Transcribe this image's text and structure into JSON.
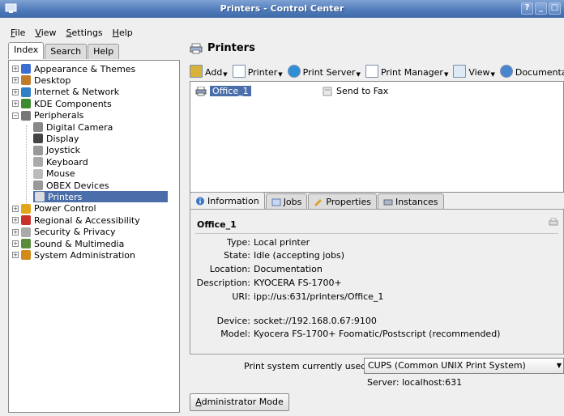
{
  "window": {
    "title": "Printers - Control Center",
    "buttons": [
      "?",
      "_",
      "□"
    ]
  },
  "menu": [
    {
      "label": "File",
      "key": "F",
      "rest": "ile"
    },
    {
      "label": "View",
      "key": "V",
      "rest": "iew"
    },
    {
      "label": "Settings",
      "key": "S",
      "rest": "ettings"
    },
    {
      "label": "Help",
      "key": "H",
      "rest": "elp"
    }
  ],
  "left_tabs": [
    "Index",
    "Search",
    "Help"
  ],
  "tree": [
    {
      "label": "Appearance & Themes",
      "expander": "+",
      "icon": "appearance-icon",
      "color": "#3a6ed1"
    },
    {
      "label": "Desktop",
      "expander": "+",
      "icon": "desktop-icon",
      "color": "#c07c2a"
    },
    {
      "label": "Internet & Network",
      "expander": "+",
      "icon": "network-icon",
      "color": "#2f7fc9"
    },
    {
      "label": "KDE Components",
      "expander": "+",
      "icon": "kde-components-icon",
      "color": "#3c8a2e"
    },
    {
      "label": "Peripherals",
      "expander": "−",
      "icon": "peripherals-icon",
      "color": "#777777"
    },
    {
      "label": "Digital Camera",
      "icon": "camera-icon",
      "color": "#888888"
    },
    {
      "label": "Display",
      "icon": "display-icon",
      "color": "#444444"
    },
    {
      "label": "Joystick",
      "icon": "joystick-icon",
      "color": "#999999"
    },
    {
      "label": "Keyboard",
      "icon": "keyboard-icon",
      "color": "#aaaaaa"
    },
    {
      "label": "Mouse",
      "icon": "mouse-icon",
      "color": "#bbbbbb"
    },
    {
      "label": "OBEX Devices",
      "icon": "obex-icon",
      "color": "#999999"
    },
    {
      "label": "Printers",
      "icon": "printer-icon",
      "color": "#dddddd",
      "selected": true
    },
    {
      "label": "Power Control",
      "expander": "+",
      "icon": "power-icon",
      "color": "#e2a51c"
    },
    {
      "label": "Regional & Accessibility",
      "expander": "+",
      "icon": "regional-icon",
      "color": "#c8322b"
    },
    {
      "label": "Security & Privacy",
      "expander": "+",
      "icon": "security-icon",
      "color": "#aaaaaa"
    },
    {
      "label": "Sound & Multimedia",
      "expander": "+",
      "icon": "sound-icon",
      "color": "#5a8a3c"
    },
    {
      "label": "System Administration",
      "expander": "+",
      "icon": "sysadmin-icon",
      "color": "#d28a1c"
    }
  ],
  "panel": {
    "title": "Printers"
  },
  "toolbar": [
    {
      "label": "Add",
      "icon": "add-wand-icon",
      "dropdown": true
    },
    {
      "label": "Printer",
      "icon": "printer-doc-icon",
      "dropdown": true
    },
    {
      "label": "Print Server",
      "icon": "print-server-icon",
      "dropdown": true
    },
    {
      "label": "Print Manager",
      "icon": "print-manager-icon",
      "dropdown": true
    },
    {
      "label": "View",
      "icon": "view-icon",
      "dropdown": true
    },
    {
      "label": "Documentation",
      "icon": "documentation-icon",
      "dropdown": true
    }
  ],
  "printers": [
    {
      "label": "Office_1",
      "icon": "printer-icon",
      "selected": true
    },
    {
      "label": "Send to Fax",
      "icon": "fax-icon",
      "selected": false
    }
  ],
  "info_tabs": [
    {
      "label": "Information",
      "icon": "info-icon",
      "active": true
    },
    {
      "label": "Jobs",
      "icon": "jobs-icon",
      "active": false
    },
    {
      "label": "Properties",
      "icon": "properties-icon",
      "active": false
    },
    {
      "label": "Instances",
      "icon": "instances-icon",
      "active": false
    }
  ],
  "info": {
    "name": "Office_1",
    "rows": [
      {
        "key": "Type:",
        "value": "Local printer"
      },
      {
        "key": "State:",
        "value": "Idle (accepting jobs)"
      },
      {
        "key": "Location:",
        "value": "Documentation"
      },
      {
        "key": "Description:",
        "value": "KYOCERA FS-1700+"
      },
      {
        "key": "URI:",
        "value": "ipp://us:631/printers/Office_1"
      },
      {
        "key": "Device:",
        "value": "socket://192.168.0.67:9100"
      },
      {
        "key": "Model:",
        "value": "Kyocera FS-1700+ Foomatic/Postscript (recommended)"
      }
    ]
  },
  "print_system": {
    "label": "Print system currently used:",
    "selected": "CUPS (Common UNIX Print System)",
    "server": "Server: localhost:631"
  },
  "admin_button": "Administrator Mode",
  "colors": {
    "titlebar": "#4e79b8",
    "selection": "#4a6ea9"
  }
}
